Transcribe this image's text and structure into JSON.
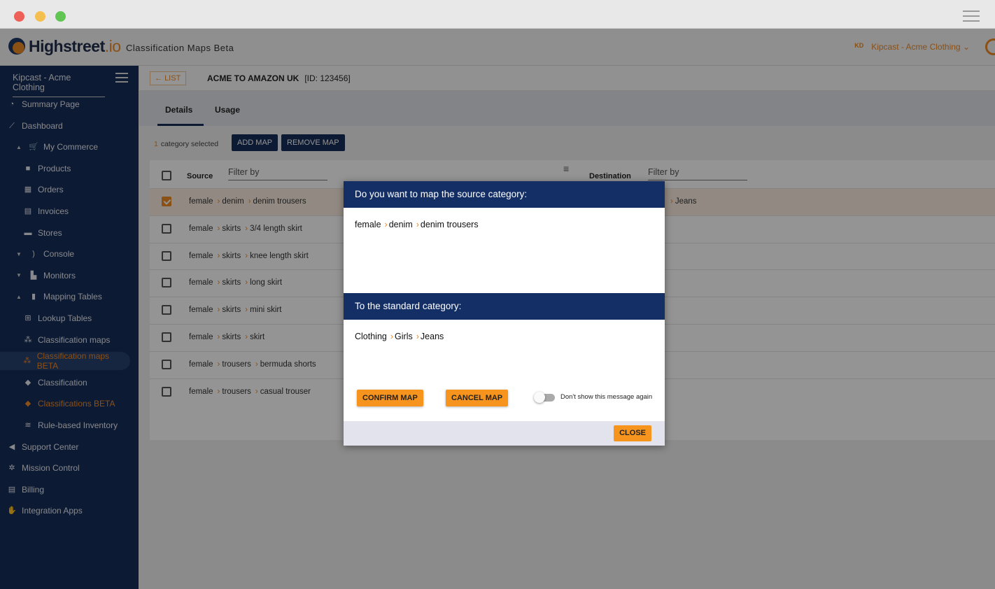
{
  "window": {
    "colors": {
      "close": "#ed5f57",
      "minimize": "#f4bf4f",
      "zoom": "#61c554"
    }
  },
  "header": {
    "brand": "Highstreet",
    "brand_suffix": ".io",
    "subtitle": "Classification Maps Beta",
    "account": "Kipcast - Acme Clothing",
    "account_badge": "KD",
    "accent": "#f08a24"
  },
  "sidebar": {
    "account": "Kipcast - Acme Clothing",
    "items": [
      {
        "label": "Summary Page",
        "icon": "dashboard-gauge-icon",
        "level": 0
      },
      {
        "label": "Dashboard",
        "icon": "line-chart-icon",
        "level": 0
      },
      {
        "label": "My Commerce",
        "icon": "cart-icon",
        "level": 0,
        "caret": "up"
      },
      {
        "label": "Products",
        "icon": "bag-icon",
        "level": 1
      },
      {
        "label": "Orders",
        "icon": "orders-icon",
        "level": 1
      },
      {
        "label": "Invoices",
        "icon": "invoice-icon",
        "level": 1
      },
      {
        "label": "Stores",
        "icon": "store-icon",
        "level": 1
      },
      {
        "label": "Console",
        "icon": "rss-icon",
        "level": 0,
        "caret": "down"
      },
      {
        "label": "Monitors",
        "icon": "monitor-chart-icon",
        "level": 0,
        "caret": "down"
      },
      {
        "label": "Mapping Tables",
        "icon": "file-icon",
        "level": 0,
        "caret": "up"
      },
      {
        "label": "Lookup Tables",
        "icon": "table-icon",
        "level": 1
      },
      {
        "label": "Classification maps",
        "icon": "sitemap-icon",
        "level": 1
      },
      {
        "label": "Classification maps BETA",
        "icon": "sitemap-icon",
        "level": 1,
        "active": true,
        "orange": true
      },
      {
        "label": "Classification",
        "icon": "tag-icon",
        "level": 1
      },
      {
        "label": "Classifications BETA",
        "icon": "tag-icon",
        "level": 1,
        "orange": true
      },
      {
        "label": "Rule-based Inventory",
        "icon": "layers-icon",
        "level": 1
      },
      {
        "label": "Support Center",
        "icon": "megaphone-icon",
        "level": 0
      },
      {
        "label": "Mission Control",
        "icon": "gears-icon",
        "level": 0
      },
      {
        "label": "Billing",
        "icon": "billing-icon",
        "level": 0
      },
      {
        "label": "Integration Apps",
        "icon": "handshake-icon",
        "level": 0
      }
    ]
  },
  "main": {
    "list_button": "LIST",
    "title": "ACME TO AMAZON UK",
    "id_label": "[ID: 123456]",
    "tabs": [
      {
        "label": "Details",
        "active": true
      },
      {
        "label": "Usage"
      }
    ],
    "selected_count": "1",
    "selected_text": "category selected",
    "add_map": "ADD MAP",
    "remove_map": "REMOVE MAP",
    "table": {
      "source_header": "Source",
      "destination_header": "Destination",
      "filter_placeholder": "Filter by",
      "rows": [
        {
          "path": [
            "female",
            "denim",
            "denim trousers"
          ],
          "checked": true,
          "dest": "Jeans"
        },
        {
          "path": [
            "female",
            "skirts",
            "3/4 length skirt"
          ]
        },
        {
          "path": [
            "female",
            "skirts",
            "knee length skirt"
          ]
        },
        {
          "path": [
            "female",
            "skirts",
            "long skirt"
          ]
        },
        {
          "path": [
            "female",
            "skirts",
            "mini skirt"
          ]
        },
        {
          "path": [
            "female",
            "skirts",
            "skirt"
          ]
        },
        {
          "path": [
            "female",
            "trousers",
            "bermuda shorts"
          ]
        },
        {
          "path": [
            "female",
            "trousers",
            "casual trouser"
          ]
        }
      ]
    }
  },
  "modal": {
    "source_title": "Do you want to map the source category:",
    "source_path": [
      "female",
      "denim",
      "denim trousers"
    ],
    "dest_title": "To the standard category:",
    "dest_path": [
      "Clothing",
      "Girls",
      "Jeans"
    ],
    "confirm": "CONFIRM MAP",
    "cancel": "CANCEL MAP",
    "toggle_label": "Don't show this message again",
    "toggle_on": false,
    "close": "CLOSE",
    "header_color": "#132f66",
    "button_color": "#f7941d"
  }
}
